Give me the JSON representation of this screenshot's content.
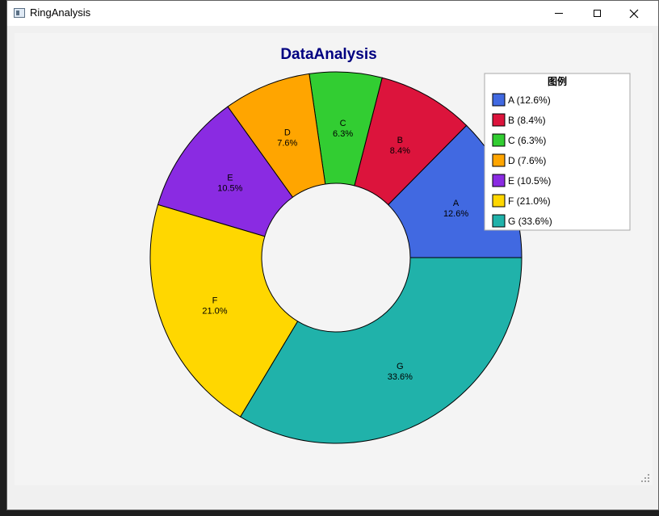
{
  "window": {
    "title": "RingAnalysis",
    "icon": "app-window-icon",
    "controls": {
      "minimize": "minimize-icon",
      "maximize": "maximize-icon",
      "close": "close-icon"
    }
  },
  "chart_data": {
    "type": "pie",
    "subtype": "donut",
    "title": "DataAnalysis",
    "legend_title": "图例",
    "legend_placement": "top-right",
    "categories": [
      "A",
      "B",
      "C",
      "D",
      "E",
      "F",
      "G"
    ],
    "values": [
      12.6,
      8.4,
      6.3,
      7.6,
      10.5,
      21.0,
      33.6
    ],
    "labels": [
      "12.6%",
      "8.4%",
      "6.3%",
      "7.6%",
      "10.5%",
      "21.0%",
      "33.6%"
    ],
    "legend_entries": [
      "A (12.6%)",
      "B (8.4%)",
      "C (6.3%)",
      "D (7.6%)",
      "E (10.5%)",
      "F (21.0%)",
      "G (33.6%)"
    ],
    "colors": [
      "#4169e1",
      "#dc143c",
      "#32cd32",
      "#ffa500",
      "#8a2be2",
      "#ffd700",
      "#20b2aa"
    ],
    "title_color": "#000080"
  }
}
